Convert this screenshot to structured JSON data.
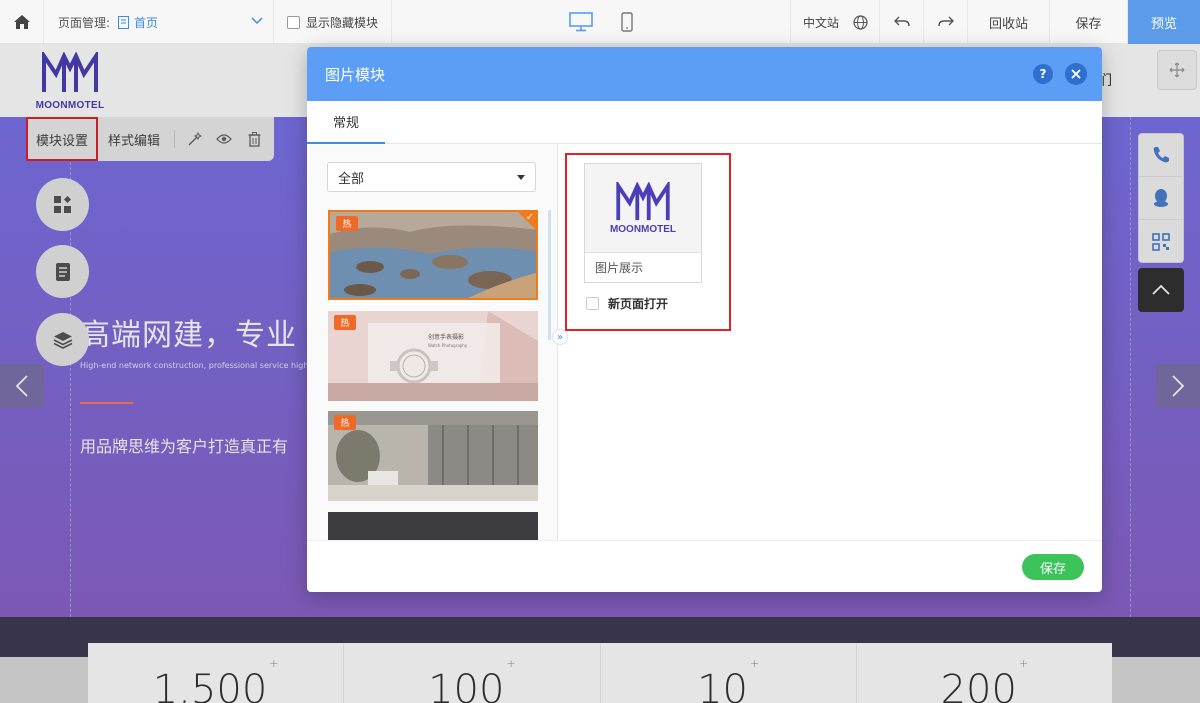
{
  "toolbar": {
    "page_manage_label": "页面管理:",
    "current_page": "首页",
    "show_hidden_label": "显示隐藏模块",
    "language": "中文站",
    "recycle_label": "回收站",
    "save_label": "保存",
    "preview_label": "预览"
  },
  "site": {
    "logo_text": "MOONMOTEL",
    "nav_fragment": "们",
    "banner_title": "高端网建，专业",
    "banner_subtitle": "High-end network construction, professional service high-c",
    "banner_desc": "用品牌思维为客户打造真正有",
    "stats": [
      {
        "value": "1,500",
        "suffix": "+"
      },
      {
        "value": "100",
        "suffix": "+"
      },
      {
        "value": "10",
        "suffix": "+"
      },
      {
        "value": "200",
        "suffix": "+"
      }
    ]
  },
  "module_toolbar": {
    "settings_label": "模块设置",
    "style_label": "样式编辑"
  },
  "dialog": {
    "title": "图片模块",
    "help_label": "?",
    "tab_general": "常规",
    "category_selected": "全部",
    "thumbnails": [
      {
        "badge": "热",
        "selected": true
      },
      {
        "badge": "热",
        "selected": false,
        "caption": "创意手表摄影",
        "caption_en": "Watch Photography"
      },
      {
        "badge": "热",
        "selected": false
      },
      {
        "badge": "",
        "selected": false
      }
    ],
    "image_card_label": "图片展示",
    "image_logo_text": "MOONMOTEL",
    "new_page_label": "新页面打开",
    "save_label": "保存"
  },
  "colors": {
    "primary_blue": "#5c9ef5",
    "save_green": "#3cc45b",
    "highlight_red": "#e0222b",
    "hot_orange": "#f06a27",
    "banner_purple": "#7a72e8"
  }
}
